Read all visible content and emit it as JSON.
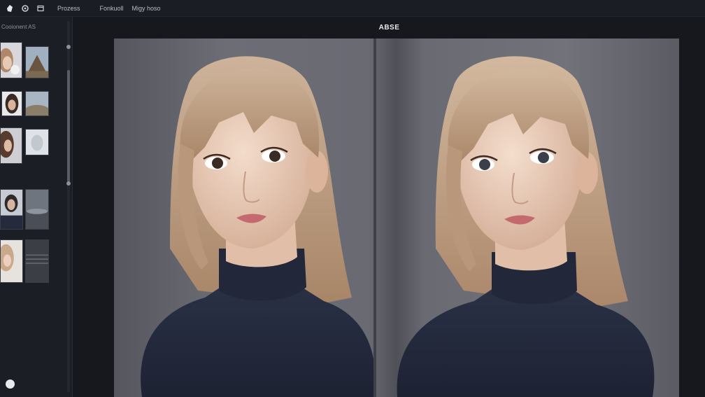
{
  "topbar": {
    "icons": [
      "app-logo-icon",
      "settings-icon",
      "window-icon"
    ],
    "menu": [
      "Prozess",
      "Fonkuoll",
      "Migy hoso"
    ]
  },
  "sidebar": {
    "heading": "Cooionent AS",
    "groups": [
      "",
      ""
    ]
  },
  "main": {
    "title": "ABSE"
  },
  "colors": {
    "background": "#15171d",
    "panel": "#1c1e25",
    "hair": "#c9a98a",
    "sweater": "#242b3d"
  }
}
